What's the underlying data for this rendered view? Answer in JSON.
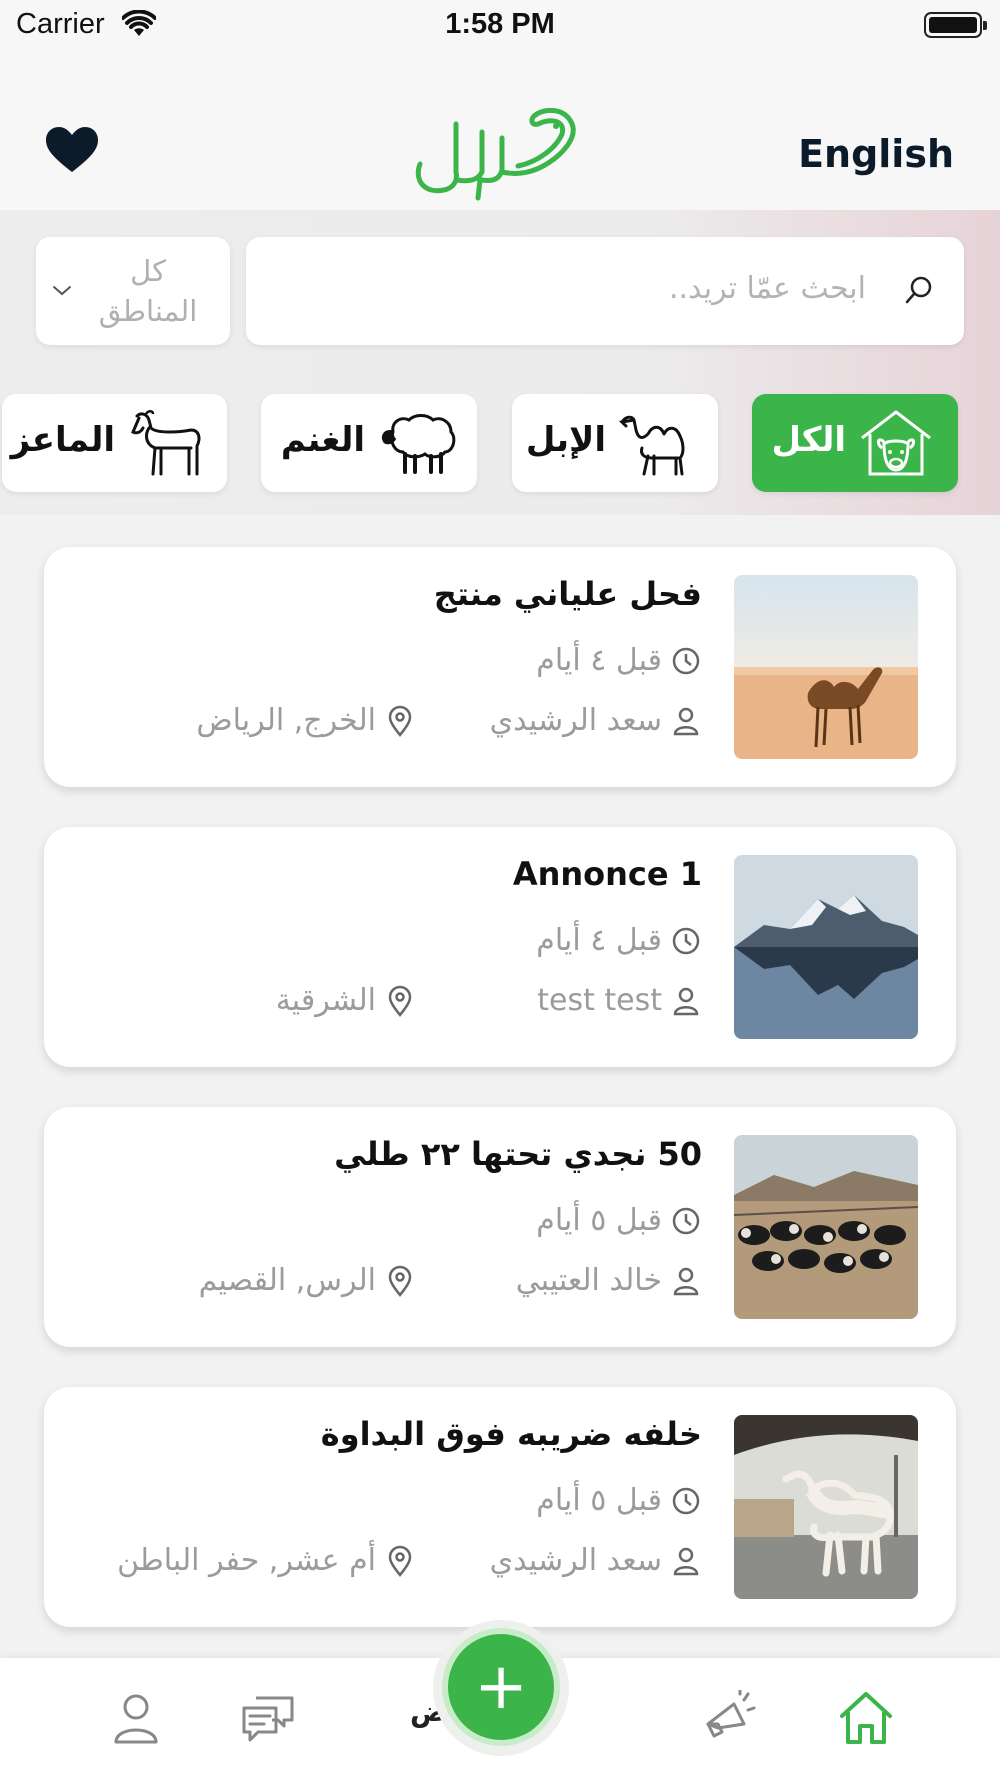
{
  "status_bar": {
    "carrier": "Carrier",
    "time": "1:58 PM"
  },
  "header": {
    "language_label": "English",
    "logo_text": "حلال"
  },
  "search": {
    "placeholder": "ابحث عمّا تريد.."
  },
  "region_filter": {
    "selected": "كل المناطق"
  },
  "categories": [
    {
      "label": "الكل",
      "icon": "livestock-barn-icon",
      "active": true
    },
    {
      "label": "الإبل",
      "icon": "camel-icon",
      "active": false
    },
    {
      "label": "الغنم",
      "icon": "sheep-icon",
      "active": false
    },
    {
      "label": "الماعز",
      "icon": "goat-icon",
      "active": false
    }
  ],
  "listings": [
    {
      "title": "فحل علياني منتج",
      "time": "قبل ٤ أيام",
      "seller": "سعد الرشيدي",
      "location": "الخرج, الرياض",
      "image": "camel-in-desert"
    },
    {
      "title": "Annonce 1",
      "time": "قبل ٤ أيام",
      "seller": "test test",
      "location": "الشرقية",
      "image": "snowy-mountain-lake"
    },
    {
      "title": "50 نجدي تحتها ٢٢ طلي",
      "time": "قبل ٥ أيام",
      "seller": "خالد العتيبي",
      "location": "الرس, القصيم",
      "image": "sheep-flock"
    },
    {
      "title": "خلفه ضريبه فوق البداوة",
      "time": "قبل ٥ أيام",
      "seller": "سعد الرشيدي",
      "location": "أم عشر,  حفر الباطن",
      "image": "white-camel-street"
    }
  ],
  "tabbar": {
    "add_symbol": "+",
    "center_label_partial": "حر ض",
    "icons": [
      "user-icon",
      "chat-icon",
      "add-icon",
      "megaphone-icon",
      "home-icon"
    ]
  },
  "colors": {
    "accent": "#3bb54a",
    "text_muted": "#9b9b9b",
    "dark": "#0c1b2a"
  }
}
